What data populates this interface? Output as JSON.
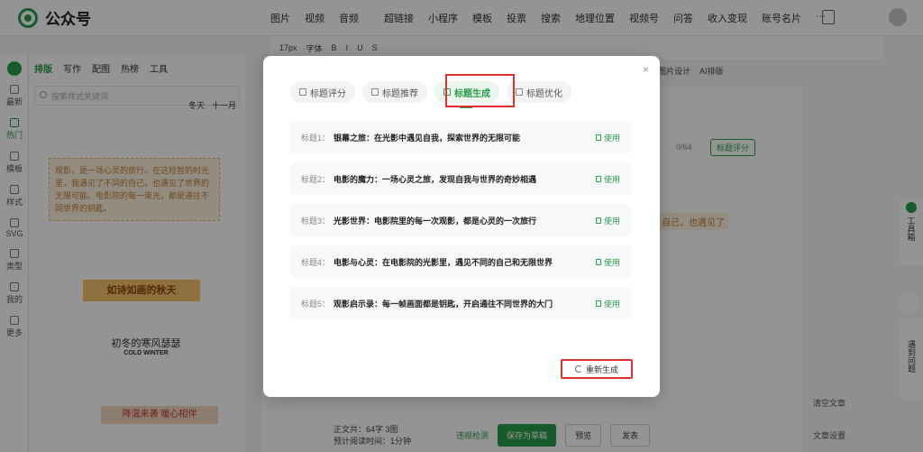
{
  "app": {
    "title": "公众号"
  },
  "topnav": [
    "图片",
    "视频",
    "音频",
    "超链接",
    "小程序",
    "模板",
    "投票",
    "搜索",
    "地理位置",
    "视频号",
    "问答",
    "收入变现",
    "账号名片",
    "···"
  ],
  "toolbar2": [
    "17px",
    "字体",
    "B",
    "I",
    "U",
    "S"
  ],
  "toolbar3": [
    "图片设计",
    "AI排版"
  ],
  "left_rail": [
    "最新",
    "热门",
    "模板",
    "样式",
    "SVG",
    "类型",
    "我的",
    "更多"
  ],
  "left_tabs": [
    "排版",
    "写作",
    "配图",
    "热榜",
    "工具"
  ],
  "left_search": {
    "placeholder": "搜索样式关键词"
  },
  "left_hot": [
    "冬天",
    "十一月"
  ],
  "left_cards": {
    "card1": "观影，是一场心灵的旅行。在这短暂的时光里，我遇见了不同的自己，也遇见了世界的无限可能。电影院的每一束光，都是通往不同世界的钥匙。",
    "card2": "如诗如画的秋天",
    "card3": "初冬的寒风瑟瑟",
    "card3_small": "COLD WINTER",
    "card4": "降温来袭 暖心相伴"
  },
  "editor": {
    "counter": "0/64",
    "score_btn": "标题评分",
    "snippet": "自己，也遇见了"
  },
  "bottom": {
    "stats_label": "正文共：",
    "stats_value": "64字 3图",
    "read_label": "预计阅读时间：",
    "read_value": "1分钟",
    "check": "违规检测",
    "save": "保存为草稿",
    "preview": "预览",
    "publish": "发表"
  },
  "right": {
    "clear": "清空文章",
    "settings": "文章设置",
    "tools": "工具箱",
    "meet": "遇到问题"
  },
  "modal": {
    "tabs": [
      "标题评分",
      "标题推荐",
      "标题生成",
      "标题优化"
    ],
    "active_tab": 2,
    "titles": [
      {
        "idx": "标题1：",
        "text": "银幕之旅：在光影中遇见自我，探索世界的无限可能",
        "use": "使用"
      },
      {
        "idx": "标题2：",
        "text": "电影的魔力：一场心灵之旅，发现自我与世界的奇妙相遇",
        "use": "使用"
      },
      {
        "idx": "标题3：",
        "text": "光影世界：电影院里的每一次观影，都是心灵的一次旅行",
        "use": "使用"
      },
      {
        "idx": "标题4：",
        "text": "电影与心灵：在电影院的光影里，遇见不同的自己和无限世界",
        "use": "使用"
      },
      {
        "idx": "标题5：",
        "text": "观影启示录：每一帧画面都是钥匙，开启通往不同世界的大门",
        "use": "使用"
      }
    ],
    "regen_label": "重新生成",
    "close": "×"
  },
  "colors": {
    "accent": "#2a9d4a",
    "highlight_box": "#e0302e"
  }
}
